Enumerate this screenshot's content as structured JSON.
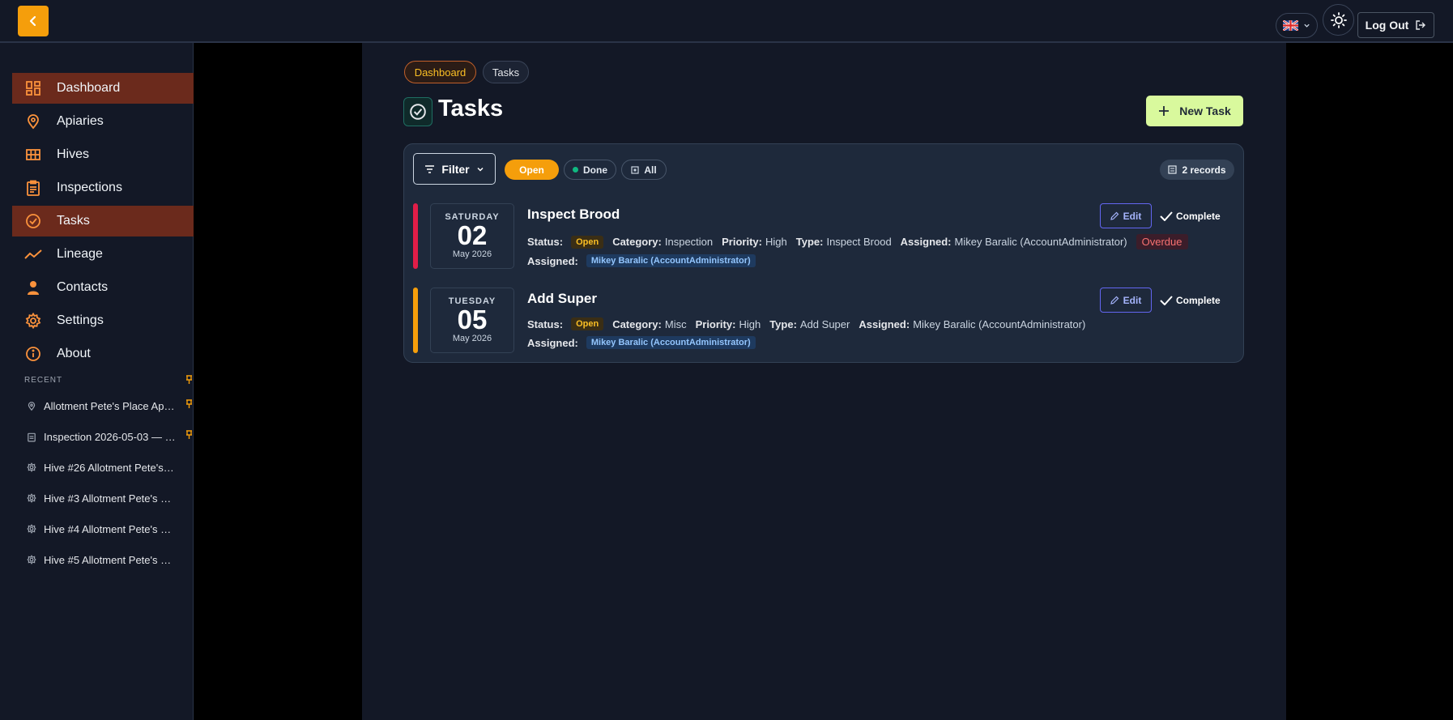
{
  "topbar": {
    "language_flag": "uk-flag-icon",
    "logout_label": "Log Out"
  },
  "sidebar": {
    "items": [
      {
        "label": "Dashboard",
        "icon": "dashboard-icon"
      },
      {
        "label": "Apiaries",
        "icon": "location-pin-icon"
      },
      {
        "label": "Hives",
        "icon": "grid-icon"
      },
      {
        "label": "Inspections",
        "icon": "clipboard-icon"
      },
      {
        "label": "Tasks",
        "icon": "check-circle-icon"
      },
      {
        "label": "Lineage",
        "icon": "trend-icon"
      },
      {
        "label": "Contacts",
        "icon": "person-icon"
      },
      {
        "label": "Settings",
        "icon": "gear-icon"
      },
      {
        "label": "About",
        "icon": "info-icon"
      }
    ],
    "recent_title": "RECENT",
    "recent": [
      {
        "label": "Allotment Pete's Place Ap…",
        "icon": "location-pin-icon"
      },
      {
        "label": "Inspection 2026-05-03 — …",
        "icon": "clipboard-icon"
      },
      {
        "label": "Hive #26 Allotment Pete's…",
        "icon": "hive-icon"
      },
      {
        "label": "Hive #3 Allotment Pete's …",
        "icon": "hive-icon"
      },
      {
        "label": "Hive #4 Allotment Pete's …",
        "icon": "hive-icon"
      },
      {
        "label": "Hive #5 Allotment Pete's …",
        "icon": "hive-icon"
      }
    ]
  },
  "breadcrumb": [
    "Dashboard",
    "Tasks"
  ],
  "page": {
    "title": "Tasks",
    "new_task_label": "New Task"
  },
  "toolbar": {
    "filter_label": "Filter",
    "pills": [
      "Open",
      "Done",
      "All"
    ],
    "records_label": "2 records"
  },
  "labels": {
    "status": "Status:",
    "category": "Category:",
    "priority": "Priority:",
    "type": "Type:",
    "assigned": "Assigned:",
    "edit": "Edit",
    "complete": "Complete"
  },
  "colors": {
    "accent": "#f59e0b",
    "overdue_bar": "#e11d48",
    "pending_bar": "#f59e0b"
  },
  "tasks": [
    {
      "weekday": "SATURDAY",
      "day": "02",
      "month_year": "May 2026",
      "title": "Inspect Brood",
      "status": "Open",
      "category": "Inspection",
      "priority": "High",
      "type": "Inspect Brood",
      "assigned": "Mikey Baralic (AccountAdministrator)",
      "overdue": "Overdue",
      "assigned_tag": "Mikey Baralic (AccountAdministrator)"
    },
    {
      "weekday": "TUESDAY",
      "day": "05",
      "month_year": "May 2026",
      "title": "Add Super",
      "status": "Open",
      "category": "Misc",
      "priority": "High",
      "type": "Add Super",
      "assigned": "Mikey Baralic (AccountAdministrator)",
      "assigned_tag": "Mikey Baralic (AccountAdministrator)"
    }
  ]
}
